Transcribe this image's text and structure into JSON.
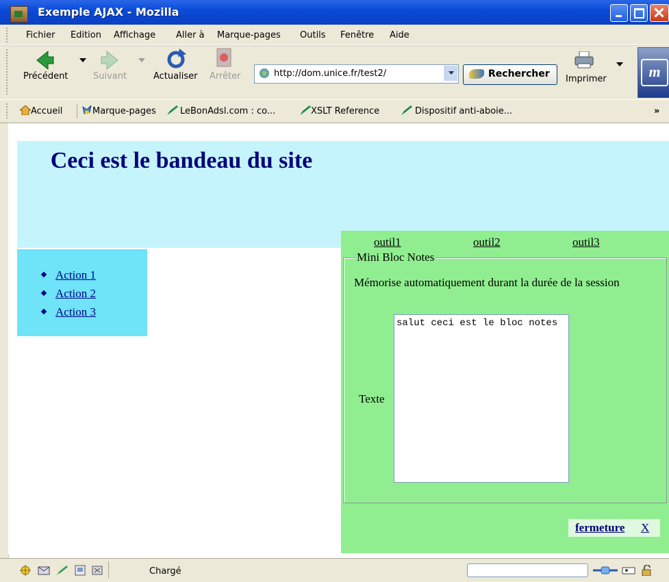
{
  "window": {
    "title": "Exemple AJAX - Mozilla",
    "controls": [
      "minimize",
      "maximize",
      "close"
    ]
  },
  "menubar": {
    "items": [
      "Fichier",
      "Edition",
      "Affichage",
      "Aller à",
      "Marque-pages",
      "Outils",
      "Fenêtre",
      "Aide"
    ]
  },
  "navbar": {
    "back": "Précédent",
    "forward": "Suivant",
    "reload": "Actualiser",
    "stop": "Arrêter",
    "url": "http://dom.unice.fr/test2/",
    "search": "Rechercher",
    "print": "Imprimer"
  },
  "bookmarks": {
    "items": [
      "Accueil",
      "Marque-pages",
      "LeBonAdsl.com : co...",
      "XSLT Reference",
      "Dispositif anti-aboie..."
    ],
    "overflow": "»"
  },
  "page": {
    "banner": "Ceci est le bandeau du site",
    "menu": [
      "Action 1",
      "Action 2",
      "Action 3"
    ],
    "tools": [
      "outil1",
      "outil2",
      "outil3"
    ],
    "notes": {
      "legend": "Mini Bloc Notes",
      "description": "Mémorise automatiquement durant la durée de la session",
      "label": "Texte",
      "content": "salut ceci est le bloc notes"
    },
    "close": {
      "label": "fermeture",
      "x": "X"
    }
  },
  "statusbar": {
    "text": "Chargé"
  },
  "colors": {
    "banner_bg": "#c5f4fc",
    "menu_bg": "#6fe3f8",
    "panel_bg": "#90ee90",
    "link": "#00008b",
    "titlebar": "#0a4bd8"
  }
}
